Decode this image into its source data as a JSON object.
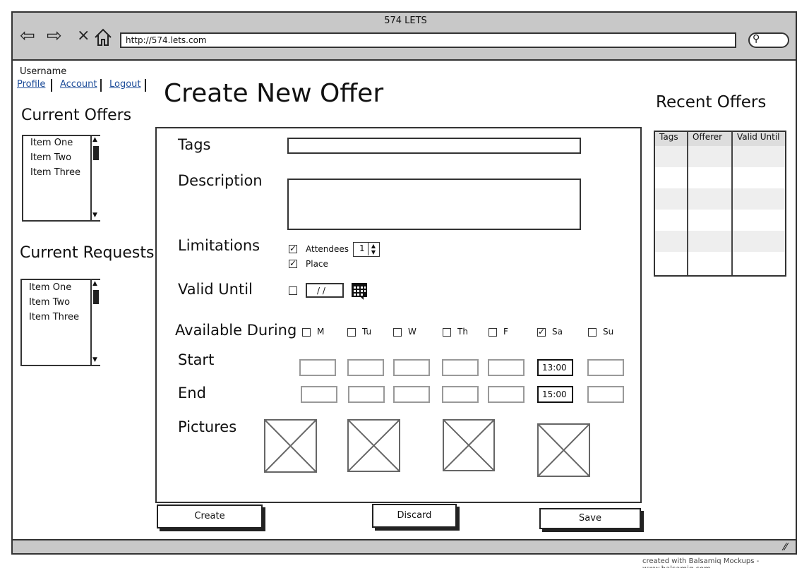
{
  "browser": {
    "title": "574 LETS",
    "url": "http://574.lets.com",
    "icons": [
      "back-arrow-icon",
      "forward-arrow-icon",
      "stop-icon",
      "home-icon",
      "search-icon"
    ]
  },
  "user": {
    "username": "Username",
    "links": [
      "Profile",
      "Account",
      "Logout"
    ]
  },
  "sidebar": {
    "offers_title": "Current Offers",
    "offers": [
      "Item One",
      "Item Two",
      "Item Three"
    ],
    "requests_title": "Current Requests",
    "requests": [
      "Item One",
      "Item Two",
      "Item Three"
    ]
  },
  "page_title": "Create New Offer",
  "form": {
    "tags_label": "Tags",
    "tags_value": "",
    "description_label": "Description",
    "description_value": "",
    "limitations_label": "Limitations",
    "attendees_label": "Attendees",
    "attendees_checked": true,
    "attendees_value": "1",
    "place_label": "Place",
    "place_checked": true,
    "valid_until_label": "Valid Until",
    "valid_until_checked": false,
    "valid_until_value": "/ /",
    "available_label": "Available During",
    "days": [
      {
        "label": "M",
        "checked": false,
        "start": "",
        "end": ""
      },
      {
        "label": "Tu",
        "checked": false,
        "start": "",
        "end": ""
      },
      {
        "label": "W",
        "checked": false,
        "start": "",
        "end": ""
      },
      {
        "label": "Th",
        "checked": false,
        "start": "",
        "end": ""
      },
      {
        "label": "F",
        "checked": false,
        "start": "",
        "end": ""
      },
      {
        "label": "Sa",
        "checked": true,
        "start": "13:00",
        "end": "15:00"
      },
      {
        "label": "Su",
        "checked": false,
        "start": "",
        "end": ""
      }
    ],
    "start_label": "Start",
    "end_label": "End",
    "pictures_label": "Pictures"
  },
  "buttons": {
    "create": "Create",
    "discard": "Discard",
    "save": "Save"
  },
  "recent": {
    "title": "Recent Offers",
    "columns": [
      "Tags",
      "Offerer",
      "Valid Until"
    ]
  },
  "footer": {
    "credit": "created with Balsamiq Mockups - www.balsamiq.com"
  }
}
